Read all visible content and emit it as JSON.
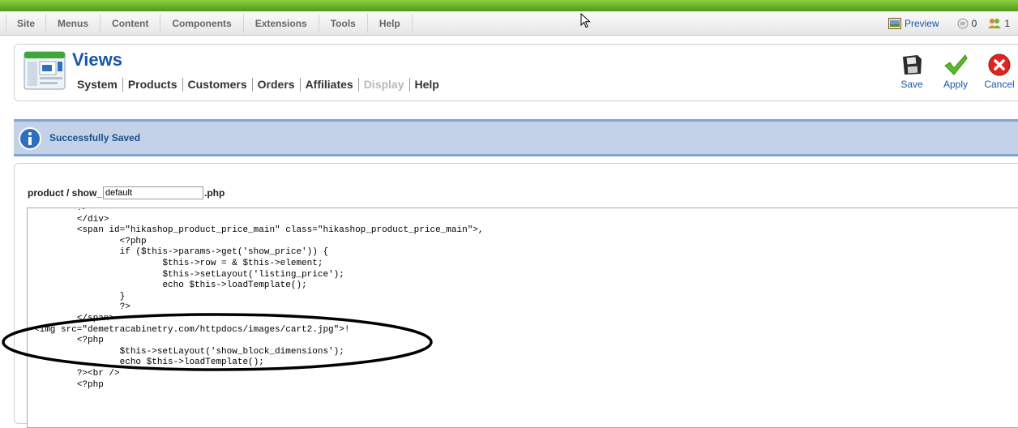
{
  "menubar": {
    "items": [
      "Site",
      "Menus",
      "Content",
      "Components",
      "Extensions",
      "Tools",
      "Help"
    ],
    "preview_label": "Preview",
    "messages_count": "0",
    "users_count": "1"
  },
  "header": {
    "title": "Views",
    "subnav": [
      {
        "label": "System",
        "disabled": false
      },
      {
        "label": "Products",
        "disabled": false
      },
      {
        "label": "Customers",
        "disabled": false
      },
      {
        "label": "Orders",
        "disabled": false
      },
      {
        "label": "Affiliates",
        "disabled": false
      },
      {
        "label": "Display",
        "disabled": true
      },
      {
        "label": "Help",
        "disabled": false
      }
    ],
    "actions": {
      "save": "Save",
      "apply": "Apply",
      "cancel": "Cancel"
    }
  },
  "message": {
    "text": "Successfully Saved"
  },
  "editor": {
    "file_prefix": "product / show_",
    "file_value": "default",
    "file_suffix": ".php",
    "code_lines": [
      "\t?>",
      "\t</div>",
      "\t<span id=\"hikashop_product_price_main\" class=\"hikashop_product_price_main\">,",
      "\t\t<?php",
      "\t\tif ($this->params->get('show_price')) {",
      "\t\t\t$this->row = & $this->element;",
      "\t\t\t$this->setLayout('listing_price');",
      "\t\t\techo $this->loadTemplate();",
      "\t\t}",
      "\t\t?>",
      "\t</span>",
      "<img src=\"demetracabinetry.com/httpdocs/images/cart2.jpg\">!",
      "\t<?php",
      "\t\t$this->setLayout('show_block_dimensions');",
      "\t\techo $this->loadTemplate();",
      "\t?><br />",
      "\t<?php"
    ]
  },
  "colors": {
    "accent_blue": "#1a56a8",
    "top_stripe": "#6bb52a",
    "message_bg": "#c3d2e6"
  },
  "icons": [
    "preview-icon",
    "messages-icon",
    "users-icon",
    "views-icon",
    "save-icon",
    "apply-icon",
    "cancel-icon",
    "info-icon",
    "mouse-cursor-icon"
  ]
}
